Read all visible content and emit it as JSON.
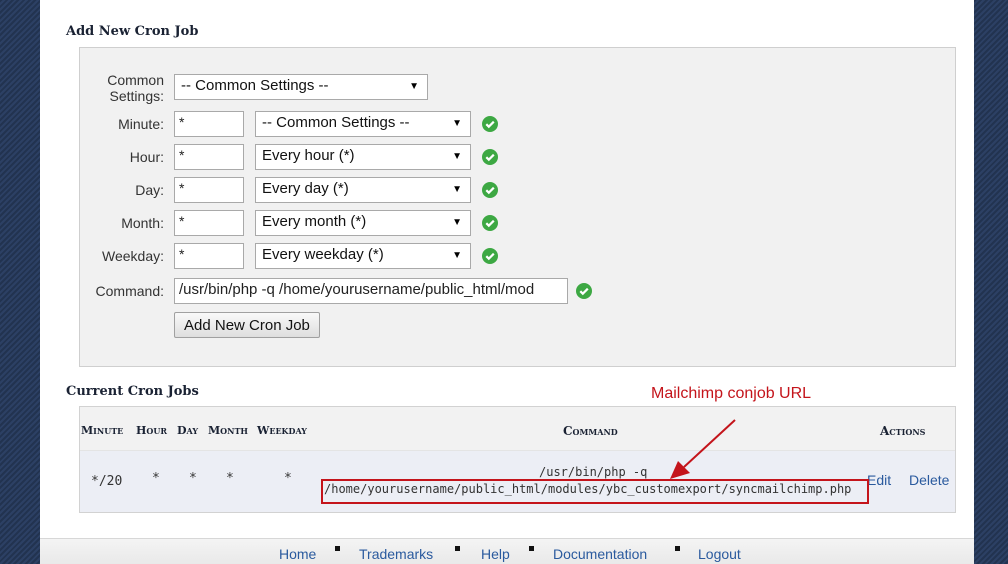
{
  "add_section": {
    "title": "Add New Cron Job"
  },
  "form": {
    "common_label_line1": "Common",
    "common_label_line2": "Settings:",
    "common_select": "-- Common Settings --",
    "rows": [
      {
        "label": "Minute:",
        "value": "*",
        "select": "-- Common Settings --"
      },
      {
        "label": "Hour:",
        "value": "*",
        "select": "Every hour (*)"
      },
      {
        "label": "Day:",
        "value": "*",
        "select": "Every day (*)"
      },
      {
        "label": "Month:",
        "value": "*",
        "select": "Every month (*)"
      },
      {
        "label": "Weekday:",
        "value": "*",
        "select": "Every weekday (*)"
      }
    ],
    "command_label": "Command:",
    "command_value": "/usr/bin/php -q /home/yourusername/public_html/mod",
    "submit_label": "Add New Cron Job"
  },
  "current_section": {
    "title": "Current Cron Jobs"
  },
  "table": {
    "headers": {
      "minute": "Minute",
      "hour": "Hour",
      "day": "Day",
      "month": "Month",
      "weekday": "Weekday",
      "command": "Command",
      "actions": "Actions"
    },
    "row": {
      "minute": "*/20",
      "hour": "*",
      "day": "*",
      "month": "*",
      "weekday": "*",
      "command_line1": "/usr/bin/php -q",
      "command_line2": "/home/yourusername/public_html/modules/ybc_customexport/syncmailchimp.php",
      "edit": "Edit",
      "delete": "Delete"
    }
  },
  "annotation": {
    "text": "Mailchimp conjob URL",
    "color": "#c4141b"
  },
  "footer": {
    "links": [
      "Home",
      "Trademarks",
      "Help",
      "Documentation",
      "Logout"
    ]
  },
  "colors": {
    "check": "#3da843",
    "link": "#2a5a9e",
    "bg_dark": "#1d2a3e"
  },
  "icons": {
    "valid": "check-circle-icon",
    "dropdown": "triangle-down-icon"
  }
}
